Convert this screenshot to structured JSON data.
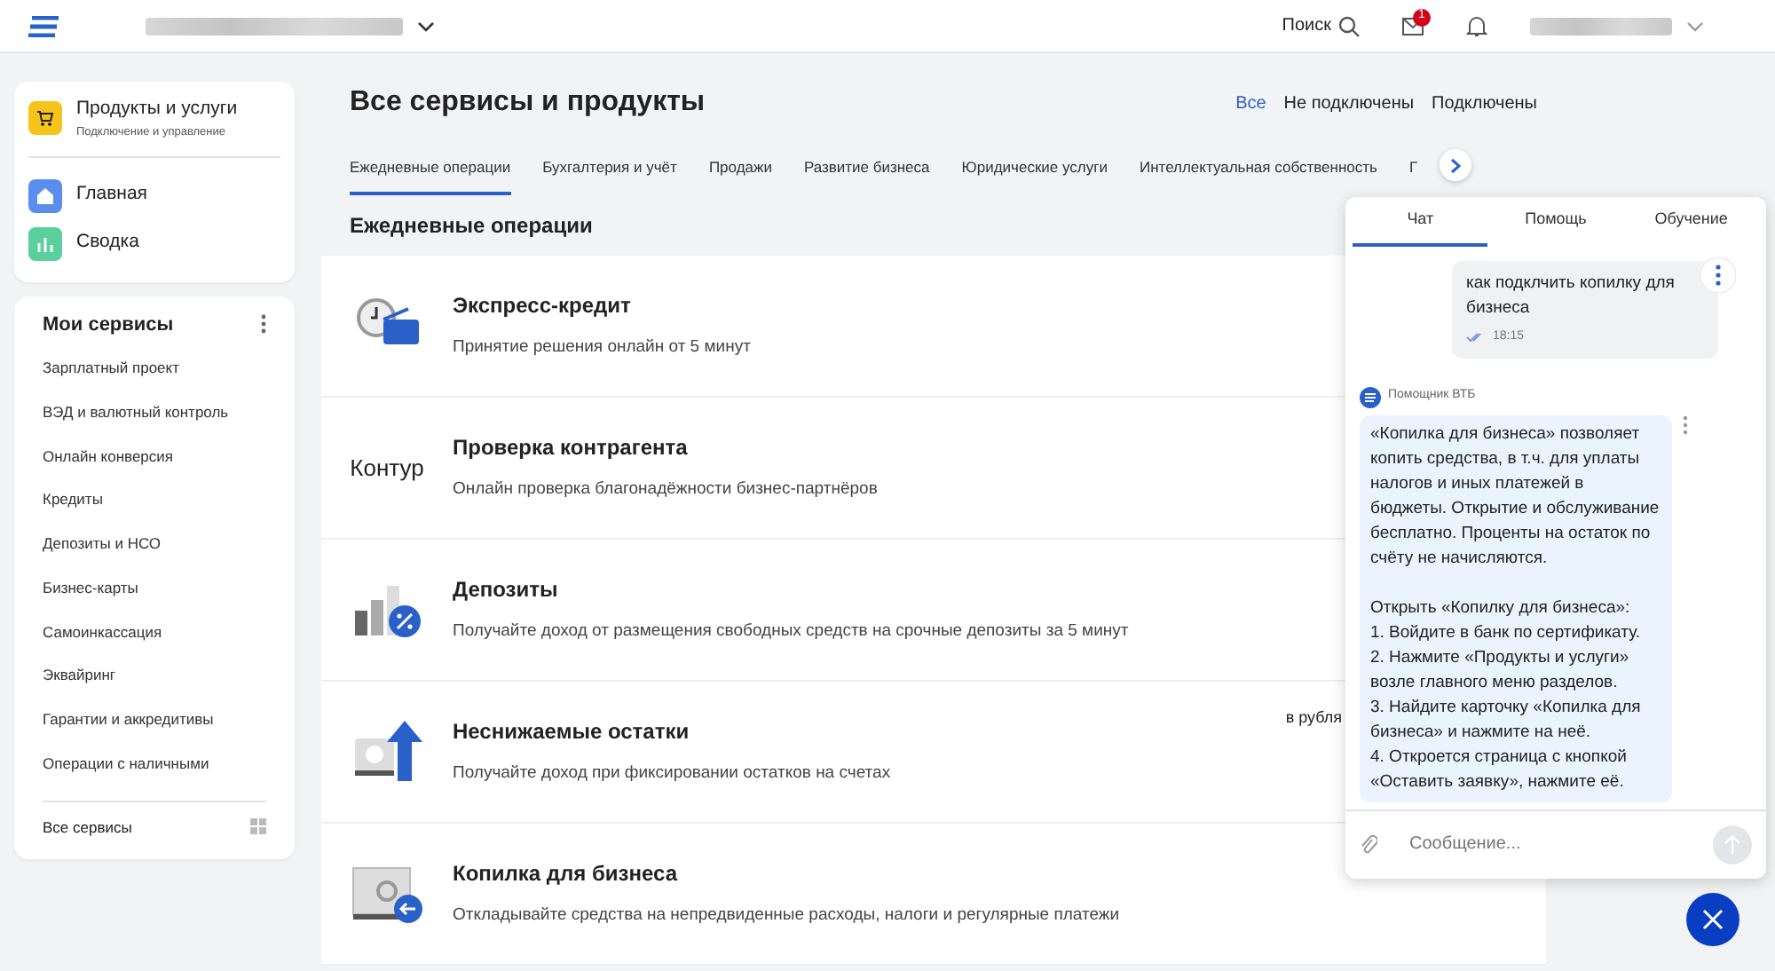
{
  "header": {
    "search_label": "Поиск",
    "mail_badge": "1"
  },
  "sidebar": {
    "products": {
      "title": "Продукты и услуги",
      "subtitle": "Подключение и управление"
    },
    "nav": [
      {
        "label": "Главная",
        "kind": "home"
      },
      {
        "label": "Сводка",
        "kind": "chart"
      }
    ],
    "my_services": {
      "title": "Мои сервисы",
      "items": [
        "Зарплатный проект",
        "ВЭД и валютный контроль",
        "Онлайн конверсия",
        "Кредиты",
        "Депозиты и НСО",
        "Бизнес-карты",
        "Самоинкассация",
        "Эквайринг",
        "Гарантии и аккредитивы",
        "Операции с наличными"
      ],
      "footer": "Все сервисы"
    }
  },
  "main": {
    "title": "Все сервисы и продукты",
    "filters": [
      {
        "label": "Все",
        "selected": true
      },
      {
        "label": "Не подключены",
        "selected": false
      },
      {
        "label": "Подключены",
        "selected": false
      }
    ],
    "tabs": [
      {
        "label": "Ежедневные операции",
        "selected": true
      },
      {
        "label": "Бухгалтерия и учёт",
        "selected": false
      },
      {
        "label": "Продажи",
        "selected": false
      },
      {
        "label": "Развитие бизнеса",
        "selected": false
      },
      {
        "label": "Юридические услуги",
        "selected": false
      },
      {
        "label": "Интеллектуальная собственность",
        "selected": false
      },
      {
        "label": "Г",
        "selected": false
      }
    ],
    "section_title": "Ежедневные операции",
    "services": [
      {
        "kind": "clock-wallet",
        "title": "Экспресс-кредит",
        "description": "Принятие решения онлайн от 5 минут"
      },
      {
        "kind": "text-logo",
        "logo": "Контур",
        "title": "Проверка контрагента",
        "description": "Онлайн проверка благонадёжности бизнес-партнёров"
      },
      {
        "kind": "percent-bars",
        "title": "Депозиты",
        "description": "Получайте доход от размещения свободных средств на срочные депозиты за 5 минут"
      },
      {
        "kind": "arrow-up",
        "title": "Неснижаемые остатки",
        "description": "Получайте доход при фиксировании остатков на счетах",
        "note": "в рубля"
      },
      {
        "kind": "safe",
        "title": "Копилка для бизнеса",
        "description": "Откладывайте средства на непредвиденные расходы, налоги и регулярные платежи"
      }
    ]
  },
  "chat": {
    "tabs": [
      {
        "label": "Чат",
        "selected": true
      },
      {
        "label": "Помощь",
        "selected": false
      },
      {
        "label": "Обучение",
        "selected": false
      }
    ],
    "user_message": {
      "text": "как подклчить копилку для бизнеса",
      "time": "18:15"
    },
    "bot": {
      "name": "Помощник ВТБ",
      "text": "«Копилка для бизнеса» позволяет копить средства, в т.ч. для уплаты налогов и иных платежей в бюджеты. Открытие и обслуживание бесплатно. Проценты на остаток по счёту не начисляются.\n\nОткрыть «Копилку для бизнеса»:\n1. Войдите в банк по сертификату.\n2. Нажмите «Продукты и услуги» возле главного меню разделов.\n3. Найдите карточку «Копилка для бизнеса» и нажмите на неё.\n4. Откроется страница с кнопкой «Оставить заявку», нажмите её."
    },
    "input": {
      "placeholder": "Сообщение..."
    }
  }
}
